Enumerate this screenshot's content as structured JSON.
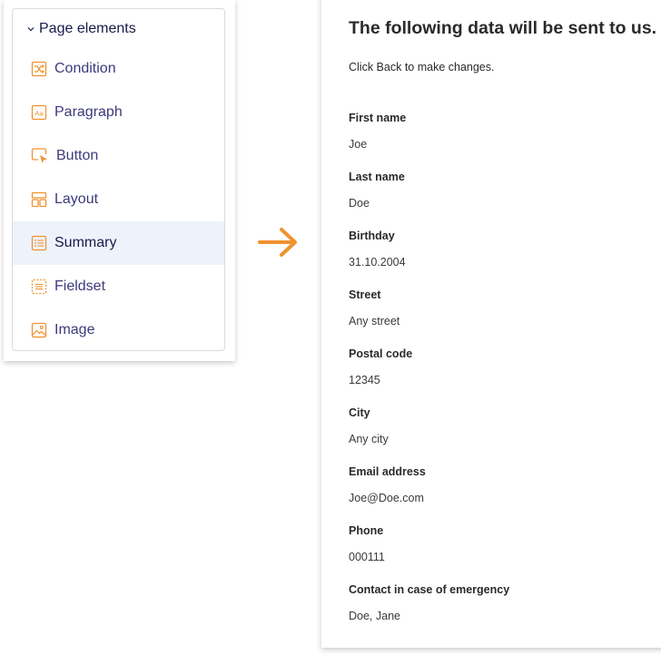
{
  "panel": {
    "title": "Page elements",
    "items": [
      {
        "label": "Condition"
      },
      {
        "label": "Paragraph"
      },
      {
        "label": "Button"
      },
      {
        "label": "Layout"
      },
      {
        "label": "Summary",
        "active": true
      },
      {
        "label": "Fieldset"
      },
      {
        "label": "Image"
      }
    ]
  },
  "summary": {
    "title": "The following data will be sent to us.",
    "subtitle": "Click Back to make changes.",
    "fields": [
      {
        "label": "First name",
        "value": "Joe"
      },
      {
        "label": "Last name",
        "value": "Doe"
      },
      {
        "label": "Birthday",
        "value": "31.10.2004"
      },
      {
        "label": "Street",
        "value": "Any street"
      },
      {
        "label": "Postal code",
        "value": "12345"
      },
      {
        "label": "City",
        "value": "Any city"
      },
      {
        "label": "Email address",
        "value": "Joe@Doe.com"
      },
      {
        "label": "Phone",
        "value": "000111"
      },
      {
        "label": "Contact in case of emergency",
        "value": "Doe, Jane"
      }
    ]
  },
  "colors": {
    "accent": "#f0922f",
    "active_row": "#eef2fb",
    "item_text": "#3c3a7a"
  }
}
